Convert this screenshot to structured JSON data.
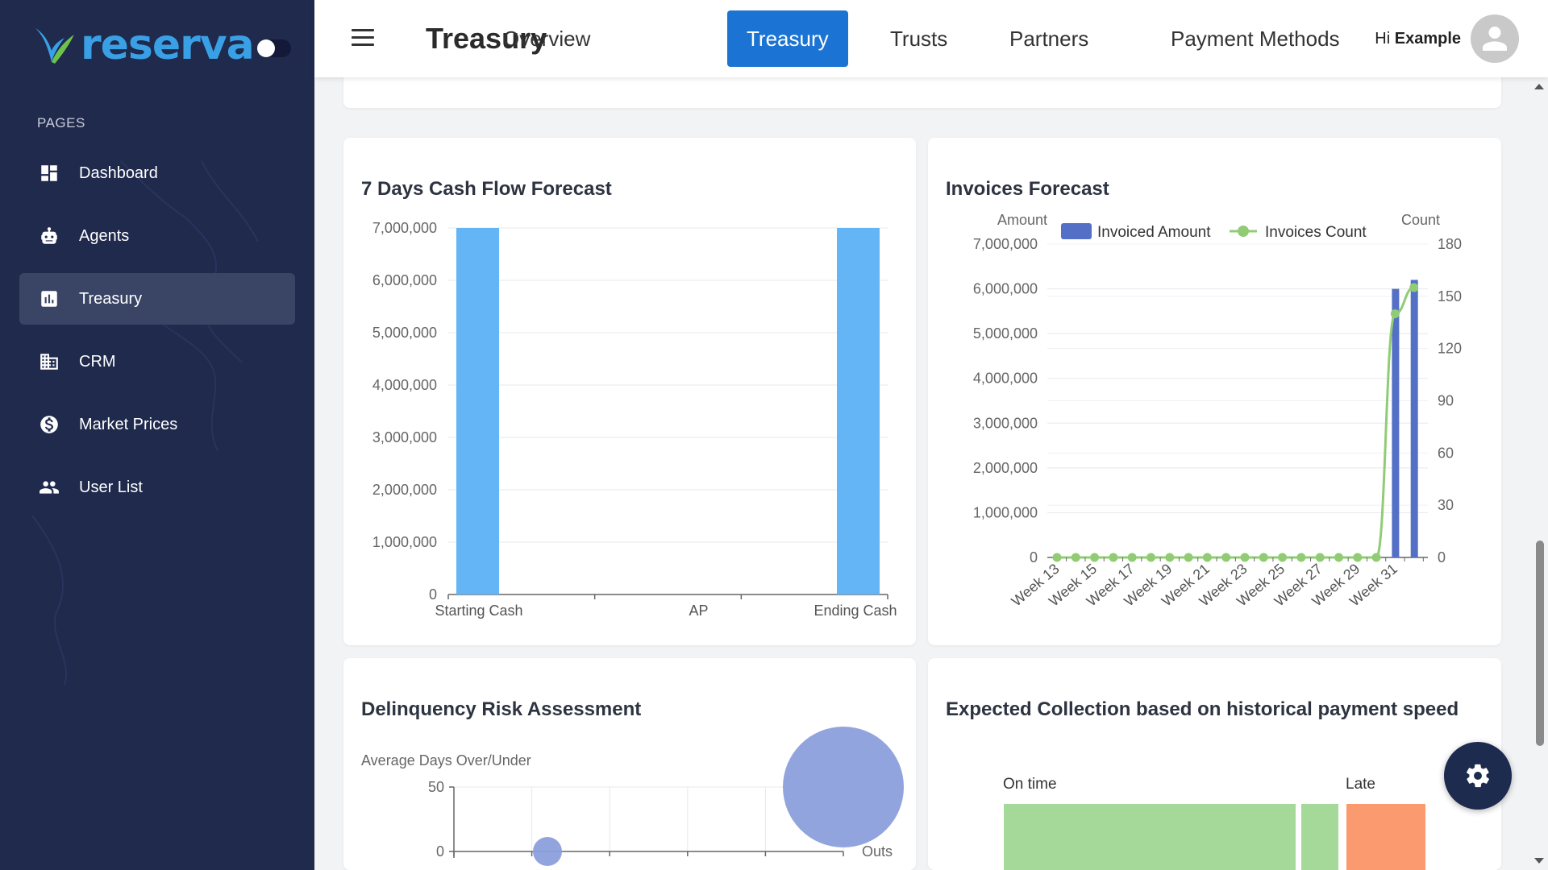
{
  "brand": {
    "name": "reserva"
  },
  "sidebar": {
    "section_label": "PAGES",
    "items": [
      {
        "label": "Dashboard",
        "icon": "dashboard-icon"
      },
      {
        "label": "Agents",
        "icon": "robot-icon"
      },
      {
        "label": "Treasury",
        "icon": "bar-chart-icon",
        "active": true
      },
      {
        "label": "CRM",
        "icon": "building-icon"
      },
      {
        "label": "Market Prices",
        "icon": "dollar-circle-icon"
      },
      {
        "label": "User List",
        "icon": "users-icon"
      }
    ]
  },
  "header": {
    "title": "Treasury",
    "tabs": [
      {
        "label": "Overview"
      },
      {
        "label": "Treasury",
        "active": true
      },
      {
        "label": "Trusts"
      },
      {
        "label": "Partners"
      },
      {
        "label": "Payment Methods"
      }
    ],
    "greeting": "Hi",
    "user_name": "Example"
  },
  "cards": {
    "cashflow_title": "7 Days Cash Flow Forecast",
    "invoices_title": "Invoices Forecast",
    "delinquency_title": "Delinquency Risk Assessment",
    "collection_title": "Expected Collection based on historical payment speed"
  },
  "colors": {
    "accent": "#1b73d3",
    "sidebar": "#1f2a4d",
    "bar_blue": "#64b5f6",
    "invoice_bar": "#5470c6",
    "invoice_line": "#91cc75",
    "ontime": "#a5d99a",
    "late": "#fb9a6e",
    "bubble": "#8c9fdb"
  },
  "chart_data": [
    {
      "type": "bar",
      "title": "7 Days Cash Flow Forecast",
      "categories": [
        "Starting Cash",
        "AP",
        "Ending Cash"
      ],
      "values": [
        7000000,
        0,
        7000000
      ],
      "ylim": [
        0,
        7000000
      ],
      "yticks": [
        0,
        1000000,
        2000000,
        3000000,
        4000000,
        5000000,
        6000000,
        7000000
      ]
    },
    {
      "type": "bar",
      "title": "Invoices Forecast",
      "categories": [
        "Week 13",
        "Week 14",
        "Week 15",
        "Week 16",
        "Week 17",
        "Week 18",
        "Week 19",
        "Week 20",
        "Week 21",
        "Week 22",
        "Week 23",
        "Week 24",
        "Week 25",
        "Week 26",
        "Week 27",
        "Week 28",
        "Week 29",
        "Week 30",
        "Week 31",
        "Week 32"
      ],
      "x_tick_labels": [
        "Week 13",
        "Week 15",
        "Week 17",
        "Week 19",
        "Week 21",
        "Week 23",
        "Week 25",
        "Week 27",
        "Week 29",
        "Week 31"
      ],
      "ylabel_left": "Amount",
      "ylabel_right": "Count",
      "legend": "top",
      "series": [
        {
          "name": "Invoiced Amount",
          "type": "bar",
          "axis": "left",
          "values": [
            0,
            0,
            0,
            0,
            0,
            0,
            0,
            0,
            0,
            0,
            0,
            0,
            0,
            0,
            0,
            0,
            0,
            0,
            6000000,
            6200000
          ]
        },
        {
          "name": "Invoices Count",
          "type": "line",
          "axis": "right",
          "values": [
            0,
            0,
            0,
            0,
            0,
            0,
            0,
            0,
            0,
            0,
            0,
            0,
            0,
            0,
            0,
            0,
            0,
            0,
            140,
            155
          ]
        }
      ],
      "ylim_left": [
        0,
        7000000
      ],
      "yticks_left": [
        0,
        1000000,
        2000000,
        3000000,
        4000000,
        5000000,
        6000000,
        7000000
      ],
      "ylim_right": [
        0,
        180
      ],
      "yticks_right": [
        0,
        30,
        60,
        90,
        120,
        150,
        180
      ]
    },
    {
      "type": "scatter",
      "title": "Delinquency Risk Assessment",
      "ylabel": "Average Days Over/Under",
      "xlabel": "Outs",
      "yticks": [
        0,
        50
      ],
      "points": [
        {
          "x": 1,
          "y": 0,
          "size": "small"
        },
        {
          "x": 5,
          "y": 50,
          "size": "large"
        }
      ]
    },
    {
      "type": "bar",
      "title": "Expected Collection based on historical payment speed",
      "categories": [
        "On time",
        "Late"
      ]
    }
  ]
}
